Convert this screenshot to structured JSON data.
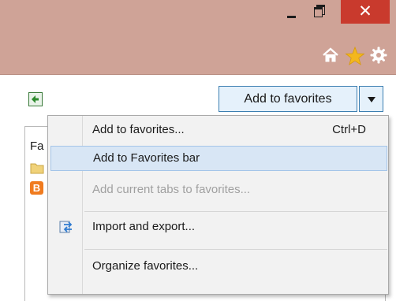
{
  "window": {
    "minimize_icon": "minimize-icon",
    "restore_icon": "restore-icon",
    "close_icon": "close-icon",
    "close_glyph": "✕",
    "colors": {
      "titlebar": "#cfa397",
      "close": "#c93a2d"
    }
  },
  "toolbar": {
    "icons": [
      "home-icon",
      "star-icon",
      "gear-icon"
    ]
  },
  "favorites": {
    "add_button_label": "Add to favorites",
    "tab_label_partial": "Fa",
    "pin_icon": "pin-icon"
  },
  "menu": {
    "items": [
      {
        "label": "Add to favorites...",
        "shortcut": "Ctrl+D"
      },
      {
        "label": "Add to Favorites bar"
      },
      {
        "label": "Add current tabs to favorites..."
      },
      {
        "label": "Import and export..."
      },
      {
        "label": "Organize favorites..."
      }
    ]
  }
}
